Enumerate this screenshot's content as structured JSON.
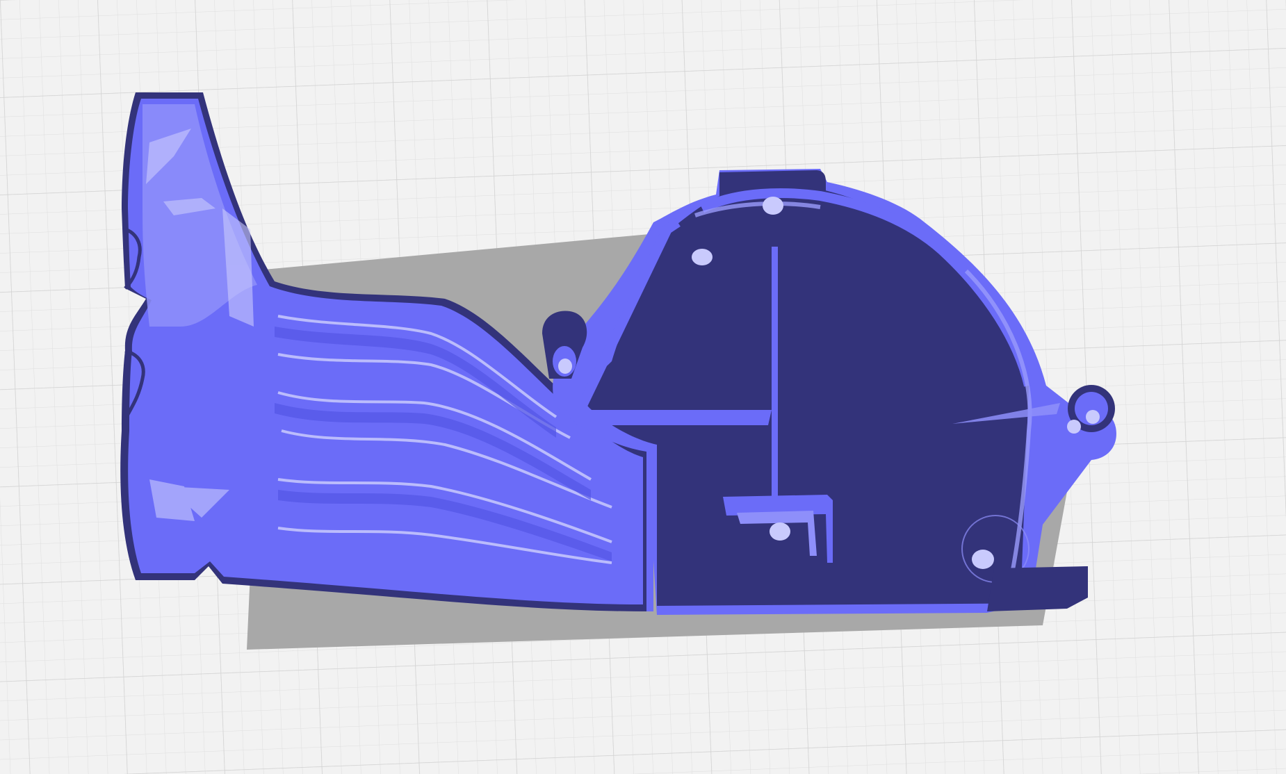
{
  "viewport": {
    "background": "#f2f2f2",
    "grid_line_color": "#dcdcdc",
    "grid_major_color": "#cfcfcf"
  },
  "model": {
    "shadow_color": "#a9a9a9",
    "body_fill": "#6b6cf8",
    "body_fill_light": "#9a9bfb",
    "outline_color": "#33337a",
    "dark_face_color": "#33337a",
    "highlight_color": "#c9cafd"
  }
}
